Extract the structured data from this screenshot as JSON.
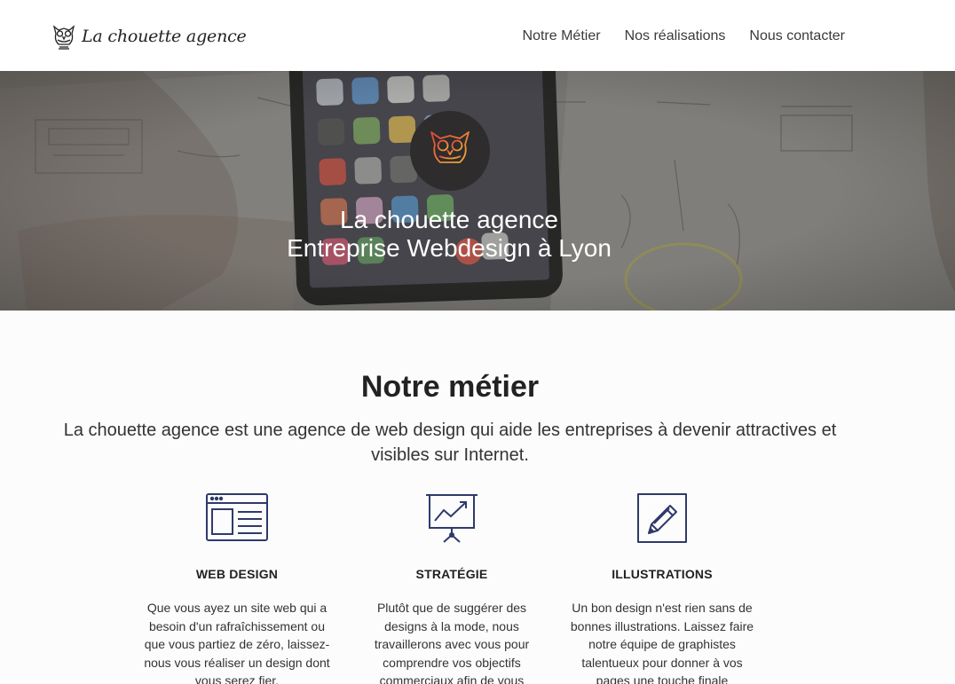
{
  "header": {
    "logo_text": "La chouette agence",
    "nav": [
      {
        "label": "Notre Métier"
      },
      {
        "label": "Nos réalisations"
      },
      {
        "label": "Nous contacter"
      }
    ]
  },
  "hero": {
    "title_line1": "La chouette agence",
    "title_line2": "Entreprise Webdesign à Lyon"
  },
  "metier": {
    "title": "Notre métier",
    "intro": "La chouette agence est une agence de web design qui aide les entreprises à devenir attractives et visibles sur Internet.",
    "features": [
      {
        "icon": "browser-window-icon",
        "title": "WEB DESIGN",
        "description": "Que vous ayez un site web qui a besoin d'un rafraîchissement ou que vous partiez de zéro, laissez-nous vous réaliser un design dont vous serez fier."
      },
      {
        "icon": "presentation-chart-icon",
        "title": "STRATÉGIE",
        "description": "Plutôt que de suggérer des designs à la mode, nous travaillerons avec vous pour comprendre vos objectifs commerciaux afin de vous"
      },
      {
        "icon": "pencil-icon",
        "title": "ILLUSTRATIONS",
        "description": "Un bon design n'est rien sans de bonnes illustrations. Laissez faire notre équipe de graphistes talentueux pour donner à vos pages une touche finale"
      }
    ]
  },
  "colors": {
    "icon_stroke": "#2f3a6b",
    "owl_gradient_start": "#e0413b",
    "owl_gradient_end": "#f0b23a",
    "hero_overlay": "#5a5855"
  }
}
